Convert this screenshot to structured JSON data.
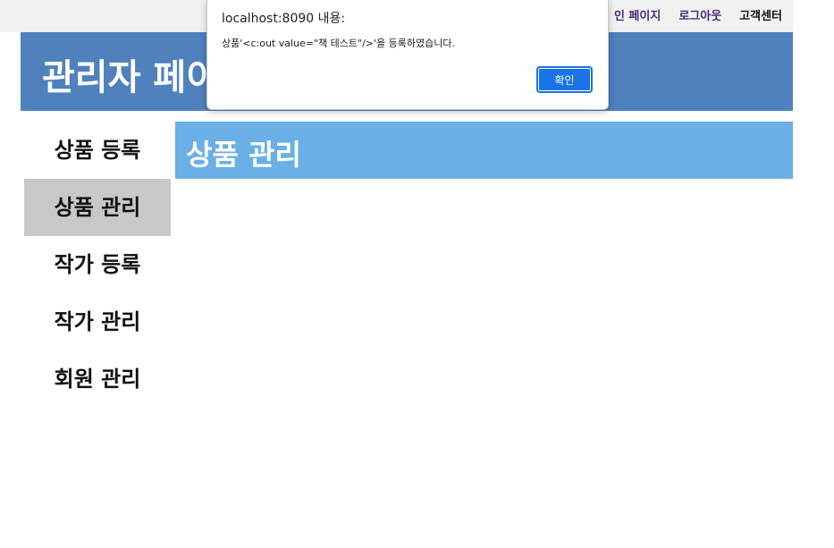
{
  "top_links": {
    "main_page": "인 페이지",
    "logout": "로그아웃",
    "customer_center": "고객센터"
  },
  "header": {
    "title": "관리자 페이"
  },
  "sidebar": {
    "items": [
      {
        "label": "상품 등록",
        "active": false
      },
      {
        "label": "상품 관리",
        "active": true
      },
      {
        "label": "작가 등록",
        "active": false
      },
      {
        "label": "작가 관리",
        "active": false
      },
      {
        "label": "회원 관리",
        "active": false
      }
    ]
  },
  "content": {
    "title": "상품 관리"
  },
  "dialog": {
    "title": "localhost:8090 내용:",
    "message": "상품'<c:out value=\"책 테스트\"/>'을 등록하였습니다.",
    "ok_label": "확인"
  },
  "colors": {
    "header_bg": "#4f81bd",
    "content_title_bg": "#6aafe6",
    "sidebar_active_bg": "#c8c8c8",
    "dialog_button": "#1a73e8"
  }
}
